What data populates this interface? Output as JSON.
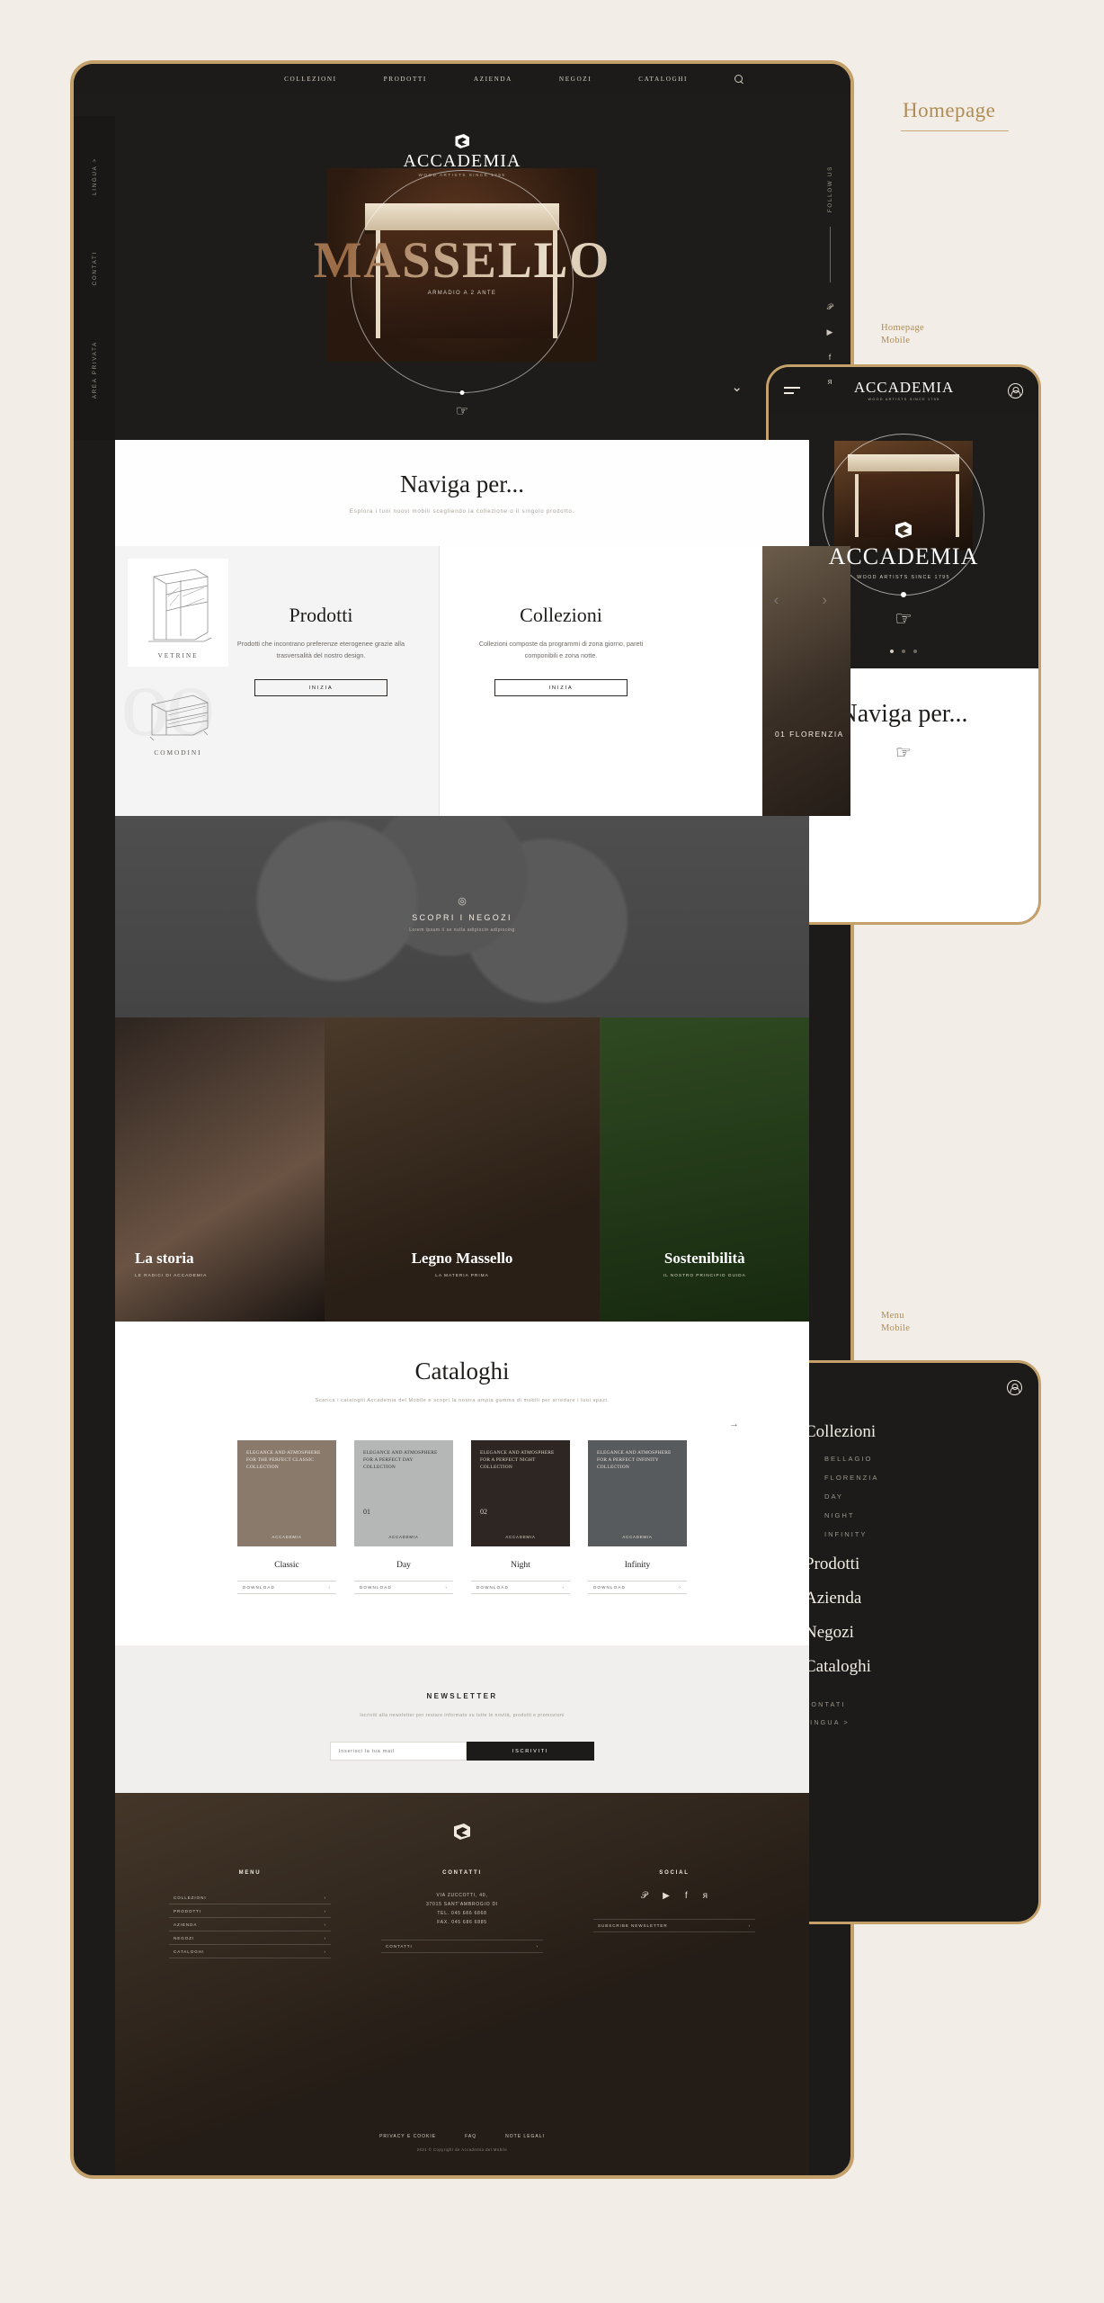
{
  "annotations": {
    "homepage": "Homepage",
    "homepage_mobile_line1": "Homepage",
    "homepage_mobile_line2": "Mobile",
    "menu_mobile_line1": "Menu",
    "menu_mobile_line2": "Mobile"
  },
  "colors": {
    "gold": "#c4a16b",
    "bg": "#f2ede6",
    "dark": "#1c1b19",
    "accent_text": "#b08d57"
  },
  "desktop": {
    "topnav": {
      "items": [
        "COLLEZIONI",
        "PRODOTTI",
        "AZIENDA",
        "NEGOZI",
        "CATALOGHI"
      ],
      "search_icon": "search-icon"
    },
    "brand": {
      "name": "ACCADEMIA",
      "tagline": "WOOD ARTISTS SINCE 1795"
    },
    "left_rail": [
      "LINGUA >",
      "CONTATI",
      "AREA PRIVATA"
    ],
    "right_rail": {
      "label": "FOLLOW US",
      "socials": [
        "twitter",
        "youtube",
        "facebook",
        "pinterest"
      ]
    },
    "hero": {
      "title": "MASSELLO",
      "subtitle": "ARMADIO A 2 ANTE",
      "scroll_icon": "hand-pointer-icon",
      "next_icon": "chevron-down-icon"
    },
    "naviga": {
      "title": "Naviga per...",
      "subtitle": "Esplora i tuoi nuovi mobili scegliendo la collezione o il singolo prodotto."
    },
    "carousel": {
      "prev_icon": "chevron-left-icon",
      "next_icon": "chevron-right-icon",
      "cards": [
        {
          "ghost": "oo",
          "title": "Prodotti",
          "body": "Prodotti che incontrano preferenze eterogenee grazie alla trasversalità del nostro design.",
          "cta": "INIZIA",
          "sketches": [
            {
              "label": "VETRINE"
            },
            {
              "label": "COMODINI"
            }
          ]
        },
        {
          "ghost": "o",
          "title": "Collezioni",
          "body": "Collezioni composte da programmi di zona giorno, pareti componibili e zona notte.",
          "cta": "INIZIA",
          "sketches": []
        },
        {
          "caption": "01 FLORENZIA"
        }
      ]
    },
    "map": {
      "pin_icon": "map-pin-icon",
      "title": "SCOPRI I NEGOZI",
      "subtitle": "Lorem ipsum il se nulla adipiscin adipiscing"
    },
    "tiles": [
      {
        "title": "La storia",
        "subtitle": "LE RADICI DI ACCADEMIA"
      },
      {
        "title": "Legno Massello",
        "subtitle": "LA MATERIA PRIMA"
      },
      {
        "title": "Sostenibilità",
        "subtitle": "IL NOSTRO PRINCIPIO GUIDA"
      }
    ],
    "cataloghi": {
      "title": "Cataloghi",
      "subtitle": "Scarica i cataloghi Accademia del Mobile e scopri la nostra ampia gamma di mobili per arredare i tuoi spazi.",
      "arrow_icon": "arrow-right-icon",
      "books": [
        {
          "cover_text": "ELEGANCE AND ATMOSPHERE FOR THE PERFECT CLASSIC COLLECTION",
          "num": "",
          "logo": "ACCADEMIA",
          "name": "Classic",
          "download": "DOWNLOAD",
          "bg": "#8a7a6c"
        },
        {
          "cover_text": "ELEGANCE AND ATMOSPHERE FOR A PERFECT DAY COLLECTION",
          "num": "01",
          "logo": "ACCADEMIA",
          "name": "Day",
          "download": "DOWNLOAD",
          "bg": "#b5b7b6"
        },
        {
          "cover_text": "ELEGANCE AND ATMOSPHERE FOR A PERFECT NIGHT COLLECTION",
          "num": "02",
          "logo": "ACCADEMIA",
          "name": "Night",
          "download": "DOWNLOAD",
          "bg": "#2e2622"
        },
        {
          "cover_text": "ELEGANCE AND ATMOSPHERE FOR A PERFECT INFINITY COLLECTION",
          "num": "",
          "logo": "ACCADEMIA",
          "name": "Infinity",
          "download": "DOWNLOAD",
          "bg": "#585b5d"
        }
      ]
    },
    "newsletter": {
      "title": "NEWSLETTER",
      "subtitle": "Iscriviti alla newsletter per restare informato su tutte le novità, prodotti e promozioni",
      "placeholder": "Inserisci la tua mail",
      "button": "ISCRIVITI"
    },
    "footer": {
      "menu_title": "MENU",
      "menu_items": [
        "COLLEZIONI",
        "PRODOTTI",
        "AZIENDA",
        "NEGOZI",
        "CATALOGHI"
      ],
      "contatti_title": "CONTATTI",
      "address": [
        "VIA ZUCCOTTI, 40,",
        "37015 SANT'AMBROGIO DI",
        "TEL. 045 686 6868",
        "FAX. 045 686 6885"
      ],
      "contatti_button": "CONTATTI",
      "social_title": "SOCIAL",
      "socials": [
        "twitter",
        "youtube",
        "facebook",
        "pinterest"
      ],
      "subscribe_button": "SUBSCRIBE NEWSLETTER",
      "bottom_links": [
        "PRIVACY E COOKIE",
        "FAQ",
        "NOTE LEGALI"
      ],
      "copyright": "2021 © Copyright de Accademia del Mobile"
    }
  },
  "mobile_home": {
    "menu_icon": "hamburger-icon",
    "account_icon": "account-icon",
    "brand": {
      "name": "ACCADEMIA",
      "tagline": "WOOD ARTISTS SINCE 1795"
    },
    "scroll_icon": "hand-pointer-icon",
    "naviga_title": "Naviga per...",
    "naviga_icon": "hand-pointer-icon",
    "dots": 3
  },
  "mobile_menu": {
    "close_icon": "close-icon",
    "account_icon": "account-icon",
    "collezioni_title": "Collezioni",
    "collezioni_items": [
      "BELLAGIO",
      "FLORENZIA",
      "DAY",
      "NIGHT",
      "INFINITY"
    ],
    "main_items": [
      "Prodotti",
      "Azienda",
      "Negozi",
      "Cataloghi"
    ],
    "footer_items": [
      "CONTATI",
      "LINGUA >"
    ]
  }
}
